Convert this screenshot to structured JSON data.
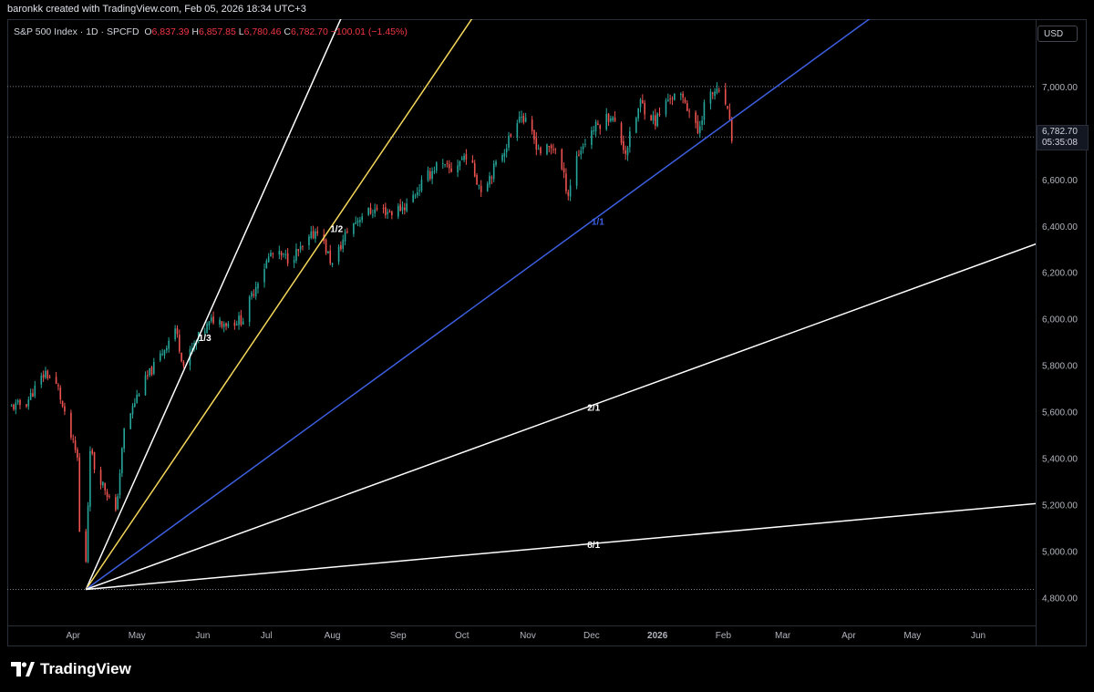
{
  "header": {
    "attribution": "baronkk created with TradingView.com, Feb 05, 2026 18:34 UTC+3"
  },
  "legend": {
    "symbol": "S&P 500 Index · 1D · SPCFD",
    "open_label": "O",
    "open": "6,837.39",
    "high_label": "H",
    "high": "6,857.85",
    "low_label": "L",
    "low": "6,780.46",
    "close_label": "C",
    "close": "6,782.70",
    "change": "−100.01 (−1.45%)"
  },
  "currency": "USD",
  "price_tag": {
    "price": "6,782.70",
    "countdown": "05:35:08"
  },
  "brand": {
    "name": "TradingView",
    "logo": "tradingview-logo-icon"
  },
  "colors": {
    "background": "#000000",
    "up": "#26a69a",
    "down": "#ef5350",
    "fan_1x1": "#3d5fe0",
    "fan_1x2": "#f5d75b",
    "fan_other": "#ffffff"
  },
  "chart_data": {
    "type": "candlestick",
    "title": "S&P 500 Index · 1D · SPCFD",
    "ylim": [
      4680,
      7290
    ],
    "y_ticks": [
      "7,000.00",
      "6,800.00",
      "6,600.00",
      "6,400.00",
      "6,200.00",
      "6,000.00",
      "5,800.00",
      "5,600.00",
      "5,400.00",
      "5,200.00",
      "5,000.00",
      "4,800.00"
    ],
    "y_tick_values": [
      7000,
      6800,
      6600,
      6400,
      6200,
      6000,
      5800,
      5600,
      5400,
      5200,
      5000,
      4800
    ],
    "x_ticks": [
      "Apr",
      "May",
      "Jun",
      "Jul",
      "Aug",
      "Sep",
      "Oct",
      "Nov",
      "Dec",
      "2026",
      "Feb",
      "Mar",
      "Apr",
      "May",
      "Jun"
    ],
    "x_tick_dates": [
      "2025-04-01",
      "2025-05-01",
      "2025-06-01",
      "2025-07-01",
      "2025-08-01",
      "2025-09-01",
      "2025-10-01",
      "2025-11-01",
      "2025-12-01",
      "2026-01-01",
      "2026-02-01",
      "2026-03-01",
      "2026-04-01",
      "2026-05-01",
      "2026-06-01"
    ],
    "date_range": [
      "2025-03-01",
      "2026-06-28"
    ],
    "close_path": [
      [
        "2025-03-03",
        5620
      ],
      [
        "2025-03-10",
        5640
      ],
      [
        "2025-03-14",
        5700
      ],
      [
        "2025-03-19",
        5770
      ],
      [
        "2025-03-25",
        5700
      ],
      [
        "2025-03-28",
        5580
      ],
      [
        "2025-04-03",
        5400
      ],
      [
        "2025-04-04",
        5080
      ],
      [
        "2025-04-07",
        4960
      ],
      [
        "2025-04-09",
        5450
      ],
      [
        "2025-04-11",
        5360
      ],
      [
        "2025-04-16",
        5270
      ],
      [
        "2025-04-21",
        5160
      ],
      [
        "2025-04-25",
        5520
      ],
      [
        "2025-05-02",
        5690
      ],
      [
        "2025-05-12",
        5840
      ],
      [
        "2025-05-19",
        5960
      ],
      [
        "2025-05-23",
        5800
      ],
      [
        "2025-05-30",
        5920
      ],
      [
        "2025-06-06",
        6000
      ],
      [
        "2025-06-13",
        5980
      ],
      [
        "2025-06-20",
        6000
      ],
      [
        "2025-06-27",
        6170
      ],
      [
        "2025-07-03",
        6280
      ],
      [
        "2025-07-11",
        6260
      ],
      [
        "2025-07-18",
        6300
      ],
      [
        "2025-07-25",
        6390
      ],
      [
        "2025-08-01",
        6230
      ],
      [
        "2025-08-08",
        6380
      ],
      [
        "2025-08-15",
        6450
      ],
      [
        "2025-08-22",
        6470
      ],
      [
        "2025-08-29",
        6460
      ],
      [
        "2025-09-05",
        6490
      ],
      [
        "2025-09-12",
        6580
      ],
      [
        "2025-09-19",
        6660
      ],
      [
        "2025-09-26",
        6640
      ],
      [
        "2025-10-03",
        6710
      ],
      [
        "2025-10-10",
        6560
      ],
      [
        "2025-10-17",
        6660
      ],
      [
        "2025-10-24",
        6790
      ],
      [
        "2025-10-28",
        6890
      ],
      [
        "2025-11-04",
        6770
      ],
      [
        "2025-11-07",
        6720
      ],
      [
        "2025-11-14",
        6740
      ],
      [
        "2025-11-20",
        6540
      ],
      [
        "2025-11-24",
        6700
      ],
      [
        "2025-12-01",
        6810
      ],
      [
        "2025-12-10",
        6880
      ],
      [
        "2025-12-17",
        6720
      ],
      [
        "2025-12-24",
        6930
      ],
      [
        "2025-12-31",
        6850
      ],
      [
        "2026-01-07",
        6960
      ],
      [
        "2026-01-14",
        6940
      ],
      [
        "2026-01-20",
        6800
      ],
      [
        "2026-01-23",
        6920
      ],
      [
        "2026-01-28",
        6980
      ],
      [
        "2026-02-02",
        6930
      ],
      [
        "2026-02-05",
        6782.7
      ]
    ],
    "last_price": 6782.7,
    "horizontal_lines": [
      7000,
      6782.7,
      4835
    ],
    "gann_fan": {
      "origin": [
        "2025-04-07",
        4835
      ],
      "lines": [
        {
          "label": "1/3",
          "color": "#ffffff",
          "through": [
            "2025-05-30",
            5920
          ]
        },
        {
          "label": "1/2",
          "color": "#f5d75b",
          "through": [
            "2025-07-31",
            6390
          ]
        },
        {
          "label": "1/1",
          "color": "#3d5fe0",
          "through": [
            "2025-12-01",
            6420
          ]
        },
        {
          "label": "2/1",
          "color": "#ffffff",
          "through": [
            "2025-11-29",
            5620
          ]
        },
        {
          "label": "8/1",
          "color": "#ffffff",
          "through": [
            "2025-11-29",
            5030
          ]
        }
      ]
    }
  }
}
